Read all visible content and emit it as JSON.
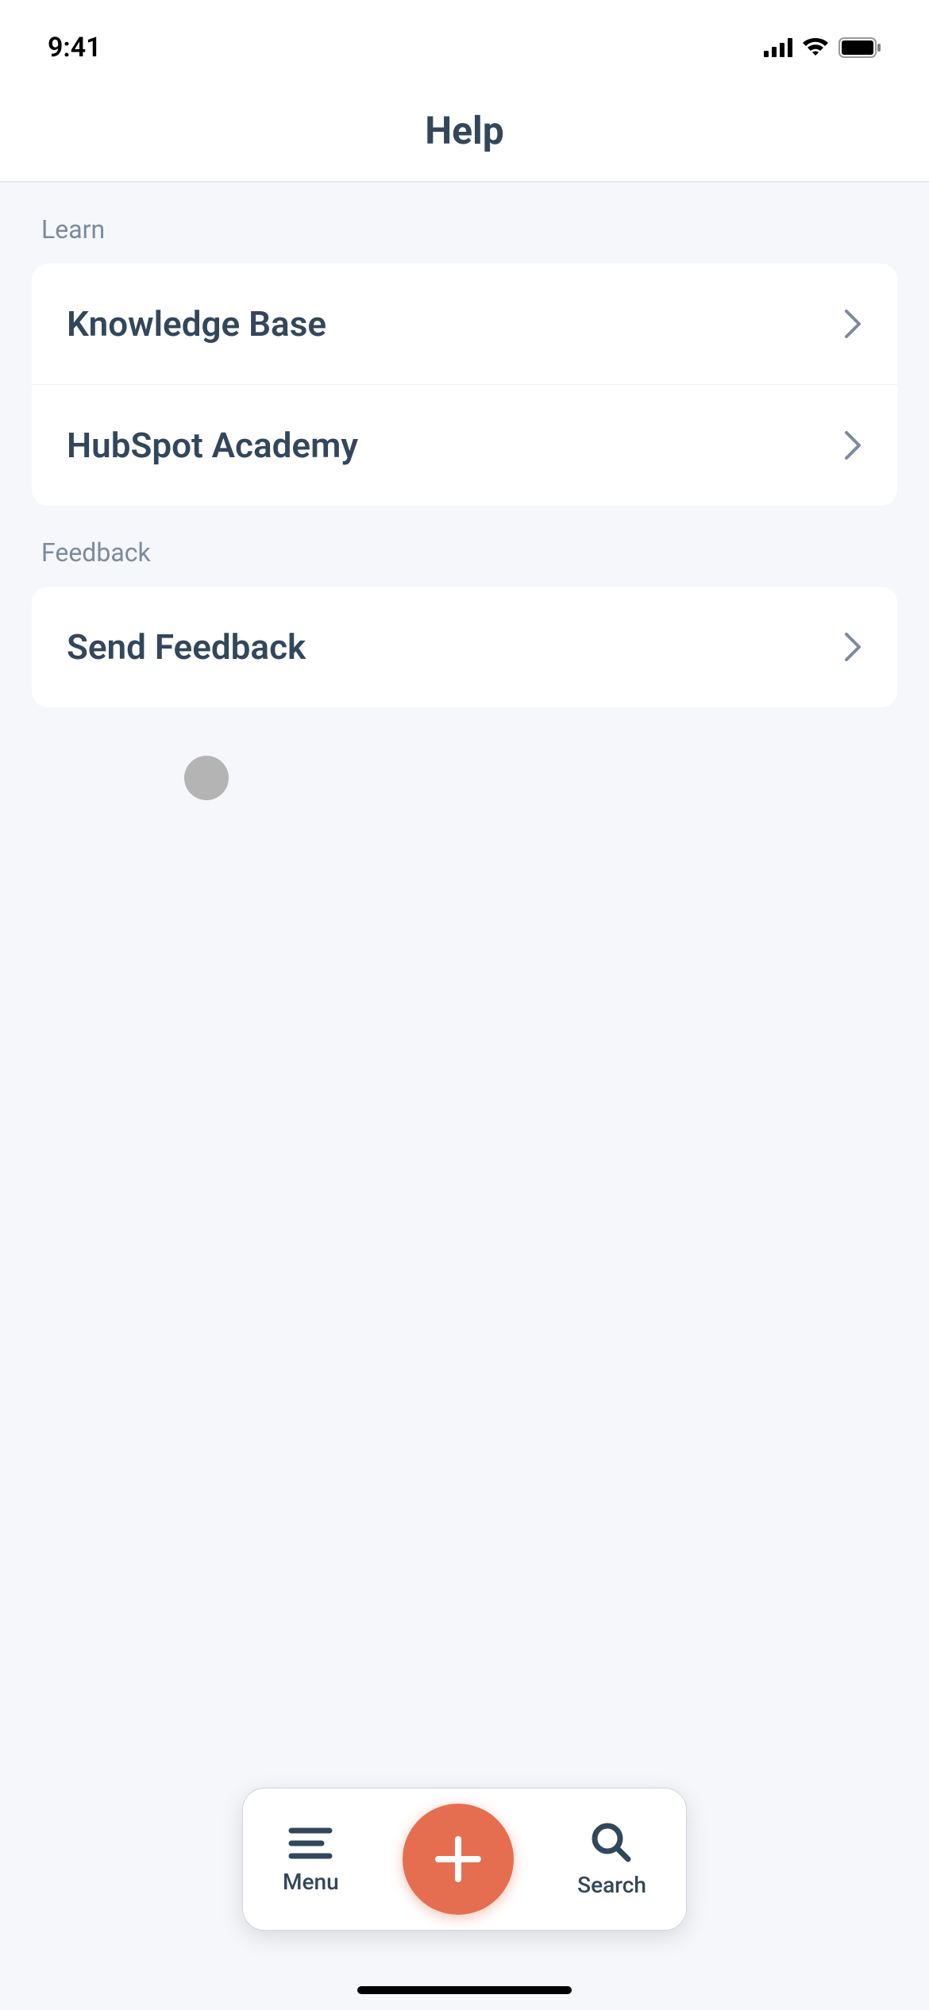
{
  "statusBar": {
    "time": "9:41"
  },
  "header": {
    "title": "Help"
  },
  "sections": {
    "learn": {
      "header": "Learn",
      "items": [
        {
          "label": "Knowledge Base"
        },
        {
          "label": "HubSpot Academy"
        }
      ]
    },
    "feedback": {
      "header": "Feedback",
      "items": [
        {
          "label": "Send Feedback"
        }
      ]
    }
  },
  "bottomBar": {
    "menu": "Menu",
    "search": "Search"
  }
}
